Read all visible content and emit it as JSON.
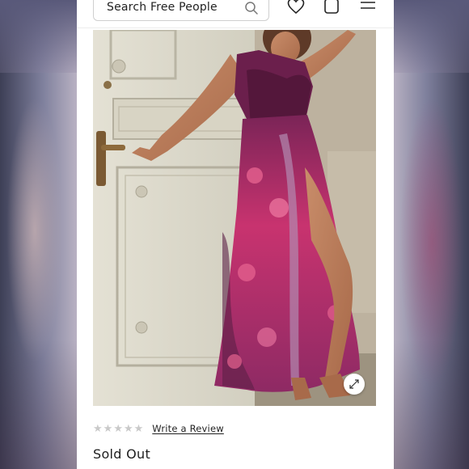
{
  "header": {
    "search": {
      "placeholder": "Search Free People"
    },
    "icons": [
      "heart-icon",
      "bag-icon",
      "menu-icon"
    ]
  },
  "product": {
    "image": {
      "subject": "woman in floral maxi dress leaning on a door",
      "zoom_icon": "expand-icon"
    },
    "rating": {
      "stars_filled": 0,
      "stars_total": 5,
      "review_link": "Write a Review"
    },
    "status": "Sold Out"
  },
  "colors": {
    "dress_pink": "#d63c7e",
    "dress_plum": "#5c1f46",
    "door": "#dcd8c8",
    "star_empty": "#c9c9c9"
  }
}
